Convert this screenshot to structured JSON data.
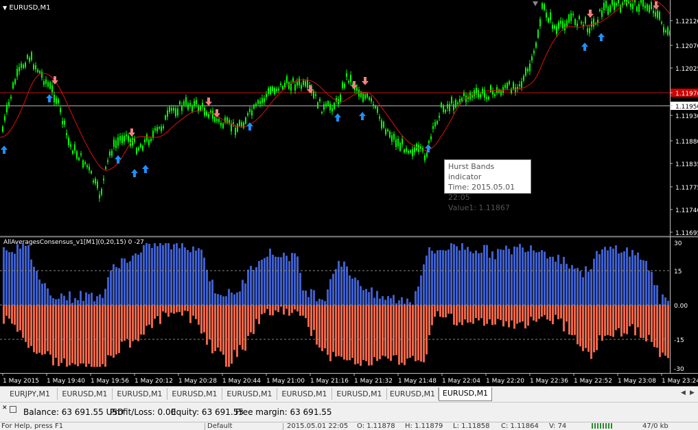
{
  "window": {
    "symbol_title": "EURUSD,M1"
  },
  "indicator_title": "AllAveragesConsensus_v1[M1](0,20,15) 0 -27",
  "price_axis": {
    "ticks": [
      "1.12120",
      "1.12070",
      "1.12025",
      "1.11976",
      "1.11950",
      "1.11930",
      "1.11880",
      "1.11835",
      "1.11775",
      "1.11740",
      "1.11695"
    ],
    "marker_red": "1.11976",
    "marker_white": "1.11950"
  },
  "ind_axis": {
    "ticks": [
      "30",
      "15",
      "0.00",
      "-15",
      "-30"
    ]
  },
  "time_axis": [
    "1 May 2015",
    "1 May 19:40",
    "1 May 19:56",
    "1 May 20:12",
    "1 May 20:28",
    "1 May 20:44",
    "1 May 21:00",
    "1 May 21:16",
    "1 May 21:32",
    "1 May 21:48",
    "1 May 22:04",
    "1 May 22:20",
    "1 May 22:36",
    "1 May 22:52",
    "1 May 23:08",
    "1 May 23:24"
  ],
  "tooltip": {
    "title": "Hurst Bands indicator",
    "time": "Time: 2015.05.01 22:05",
    "value": "Value1: 1.11867"
  },
  "tabs": [
    "EURJPY,M1",
    "EURUSD,M1",
    "EURUSD,M1",
    "EURUSD,M1",
    "EURUSD,M1",
    "EURUSD,M1",
    "EURUSD,M1",
    "EURUSD,M1",
    "EURUSD,M1"
  ],
  "active_tab_index": 8,
  "status": {
    "balance": "Balance: 63 691.55 USD",
    "profit": "Profit/Loss: 0.00",
    "equity": "Equity: 63 691.55",
    "free_margin": "Free margin: 63 691.55"
  },
  "status_bottom": [
    "For Help, press F1",
    "Default",
    "2015.05.01 22:05",
    "O: 1.11878",
    "H: 1.11879",
    "L: 1.11858",
    "C: 1.11864",
    "V: 74",
    "47/0 kb"
  ],
  "colors": {
    "background": "#000000",
    "candle": "#00ff00",
    "band": "#ff0000",
    "up_arrow": "#1e90ff",
    "down_arrow": "#f08080",
    "hist_pos": "#3f5fcf",
    "hist_neg": "#f0674a"
  }
}
